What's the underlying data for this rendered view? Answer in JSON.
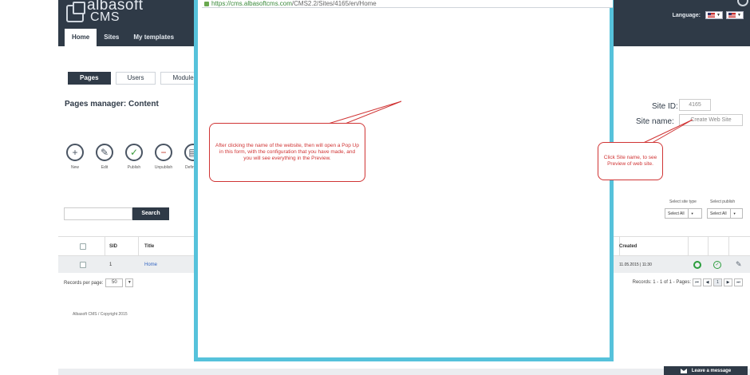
{
  "header": {
    "logo_top": "albasoft",
    "logo_bottom": "CMS",
    "nav": [
      "Home",
      "Sites",
      "My templates"
    ],
    "language_label": "Language:"
  },
  "section_tabs": [
    "Pages",
    "Users",
    "Modules"
  ],
  "page_title": "Pages manager: Content",
  "actions": [
    {
      "label": "New",
      "icon": "plus-icon"
    },
    {
      "label": "Edit",
      "icon": "pencil-icon"
    },
    {
      "label": "Publish",
      "icon": "check-circle-icon"
    },
    {
      "label": "Unpublish",
      "icon": "minus-circle-icon"
    },
    {
      "label": "Define m",
      "icon": "define-icon"
    }
  ],
  "search": {
    "value": "",
    "button": "Search"
  },
  "table": {
    "headers": {
      "sid": "SID",
      "title": "Title",
      "created": "Created"
    },
    "rows": [
      {
        "sid": "1",
        "title": "Home",
        "created": "11.05.2015 | 11:30"
      }
    ]
  },
  "records_per_page": {
    "label": "Records per page:",
    "value": "50"
  },
  "records_info": "Records: 1 - 1 of 1 - Pages:",
  "pagination": {
    "first": "⏮",
    "prev": "◀",
    "current": "1",
    "next": "▶",
    "last": "⏭"
  },
  "copyright": "Albasoft CMS / Copyright 2015",
  "site": {
    "id_label": "Site ID:",
    "id_value": "4165",
    "name_label": "Site name:",
    "name_value": "Create Web Site"
  },
  "filters": {
    "site_type_label": "Select site type",
    "publish_label": "Select publish",
    "site_type_value": "Select All",
    "publish_value": "Select All"
  },
  "popup": {
    "url_main": "https://cms.albasoftcms.com",
    "url_path": "/CMS2.2/Sites/4165/en/Home"
  },
  "callouts": {
    "main": "After clicking the name of the website, then will open a Pop Up in this form, with the configuration that you have made, and you will see everything in the Preview.",
    "right": "Click Site name, to see Preview of web site."
  },
  "footer": {
    "leave_message": "Leave a message"
  },
  "colors": {
    "header": "#2f3a47",
    "popup_border": "#56c2db",
    "callout": "#d03434",
    "status_green": "#2a9d3c"
  }
}
